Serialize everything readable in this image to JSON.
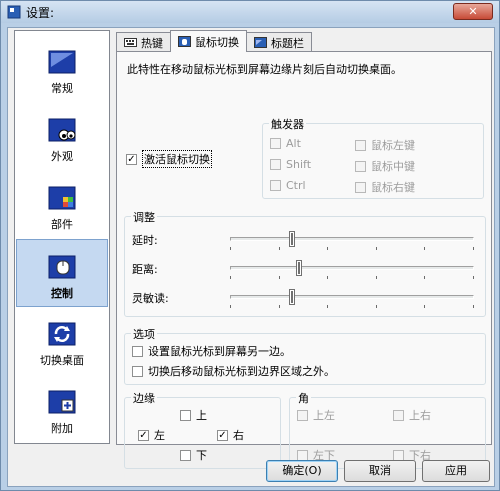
{
  "window": {
    "title": "设置:",
    "close_label": "✕"
  },
  "sidebar": {
    "items": [
      {
        "label": "常规",
        "icon": "general-icon"
      },
      {
        "label": "外观",
        "icon": "appearance-icon"
      },
      {
        "label": "部件",
        "icon": "components-icon"
      },
      {
        "label": "控制",
        "icon": "control-icon",
        "selected": true
      },
      {
        "label": "切换桌面",
        "icon": "switch-desktop-icon"
      },
      {
        "label": "附加",
        "icon": "addon-icon"
      }
    ]
  },
  "tabs": [
    {
      "label": "热键",
      "active": false
    },
    {
      "label": "鼠标切换",
      "active": true
    },
    {
      "label": "标题栏",
      "active": false
    }
  ],
  "mouse_switch": {
    "description": "此特性在移动鼠标光标到屏幕边缘片刻后自动切换桌面。",
    "activate_label": "激活鼠标切换",
    "activate_checked": true,
    "trigger": {
      "title": "触发器",
      "alt": "Alt",
      "shift": "Shift",
      "ctrl": "Ctrl",
      "left_button": "鼠标左键",
      "middle_button": "鼠标中键",
      "right_button": "鼠标右键"
    },
    "adjust": {
      "title": "调整",
      "delay_label": "延时:",
      "delay_value": 0.25,
      "distance_label": "距离:",
      "distance_value": 0.28,
      "sensitivity_label": "灵敏读:",
      "sensitivity_value": 0.25
    },
    "options": {
      "title": "选项",
      "move_cursor_label": "设置鼠标光标到屏幕另一边。",
      "move_cursor_outside_label": "切换后移动鼠标光标到边界区域之外。"
    },
    "edges": {
      "title": "边缘",
      "top": "上",
      "left": "左",
      "right": "右",
      "bottom": "下",
      "left_checked": true,
      "right_checked": true
    },
    "corners": {
      "title": "角",
      "top_left": "上左",
      "top_right": "上右",
      "bottom_left": "左下",
      "bottom_right": "下右"
    }
  },
  "buttons": {
    "ok": "确定(O)",
    "cancel": "取消",
    "apply": "应用"
  },
  "colors": {
    "selection": "#c5d9f1",
    "icon_blue": "#1d3ea8"
  }
}
